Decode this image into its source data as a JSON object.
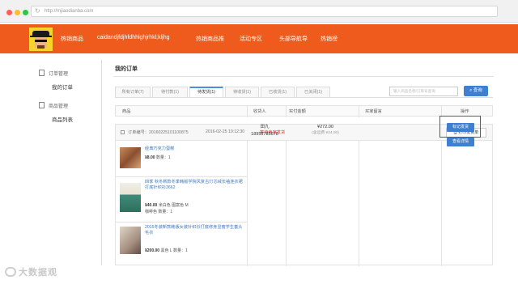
{
  "browser": {
    "url": "http://mjiaodianba.com"
  },
  "topnav": {
    "items": [
      "热销商品",
      "caidandjfdjhfdhhlghjrhkl;kljhg",
      "热销商品推",
      "活动专区",
      "头部导航导",
      "热销榜"
    ]
  },
  "sidebar": {
    "groups": [
      {
        "title": "订单管理",
        "icon": "document-icon",
        "items": [
          "我的订单"
        ]
      },
      {
        "title": "商品管理",
        "icon": "trash-icon",
        "items": [
          "商品列表"
        ]
      }
    ]
  },
  "main": {
    "title": "我的订单",
    "tabs": [
      {
        "label": "所有订单(7)",
        "active": false
      },
      {
        "label": "待付款(1)",
        "active": false
      },
      {
        "label": "待发货(1)",
        "active": true
      },
      {
        "label": "待收货(1)",
        "active": false
      },
      {
        "label": "已收货(1)",
        "active": false
      },
      {
        "label": "已关闭(1)",
        "active": false
      }
    ],
    "search_placeholder": "输入商品名称/订单号查询",
    "search_button": "查询",
    "columns": [
      "商品",
      "收货人",
      "实付金额",
      "买家留言",
      "操作"
    ],
    "order": {
      "order_no_label": "订单编号：20160225101100875",
      "time": "2016-02-25 19:12:30",
      "status": "等待卖家发货",
      "print_button": "打印发货单",
      "products": [
        {
          "name": "经典巧克力蛋糕",
          "price": "¥8.00",
          "qty": "数量：1",
          "spec": ""
        },
        {
          "name": "四季 秋冬新款冬季韩版学院风复古灯芯绒长袖连衣裙打底针织衫3662",
          "price": "¥40.00",
          "qty": "数量：1",
          "spec": "米白色 图案色 M",
          "spec2": "咖啡色 数量：1"
        },
        {
          "name": "2015冬装新款韩版女装针织衫打底修身显瘦学生套头毛衣",
          "price": "¥200.00",
          "qty": "数量：1",
          "spec": "黑色 L"
        }
      ],
      "buyer_name": "田九",
      "buyer_phone": "18956785678",
      "amount": "¥272.00",
      "amount_note": "(含运费 ¥24.00)",
      "mark_shipped_button": "标记发货",
      "detail_button": "查看详情"
    }
  },
  "watermark": {
    "text": "大数据观"
  },
  "colors": {
    "nav": "#ef5b1c",
    "accent": "#3f7fd0",
    "status": "#e02e2e",
    "highlight": "#d9262c"
  }
}
